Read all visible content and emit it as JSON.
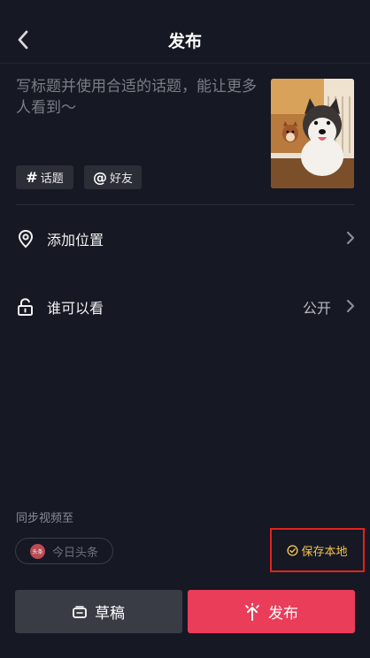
{
  "header": {
    "title": "发布",
    "back_icon": "chevron-left-icon"
  },
  "caption": {
    "placeholder": "写标题并使用合适的话题，能让更多人看到～"
  },
  "chips": [
    {
      "symbol": "#",
      "label": "话题",
      "icon": "hashtag-icon"
    },
    {
      "symbol": "@",
      "label": "好友",
      "icon": "at-icon"
    }
  ],
  "rows": {
    "location": {
      "label": "添加位置",
      "icon": "location-pin-icon"
    },
    "visibility": {
      "label": "谁可以看",
      "value": "公开",
      "icon": "unlock-icon"
    }
  },
  "sync": {
    "label": "同步视频至",
    "toutiao": {
      "label": "今日头条",
      "logo_text": "头条"
    },
    "save_local": {
      "label": "保存本地",
      "checked": true,
      "accent": "#f5c44c"
    }
  },
  "buttons": {
    "draft": {
      "label": "草稿",
      "icon": "draft-box-icon"
    },
    "publish": {
      "label": "发布",
      "icon": "publish-arrow-icon",
      "color": "#ea3d5a"
    }
  }
}
